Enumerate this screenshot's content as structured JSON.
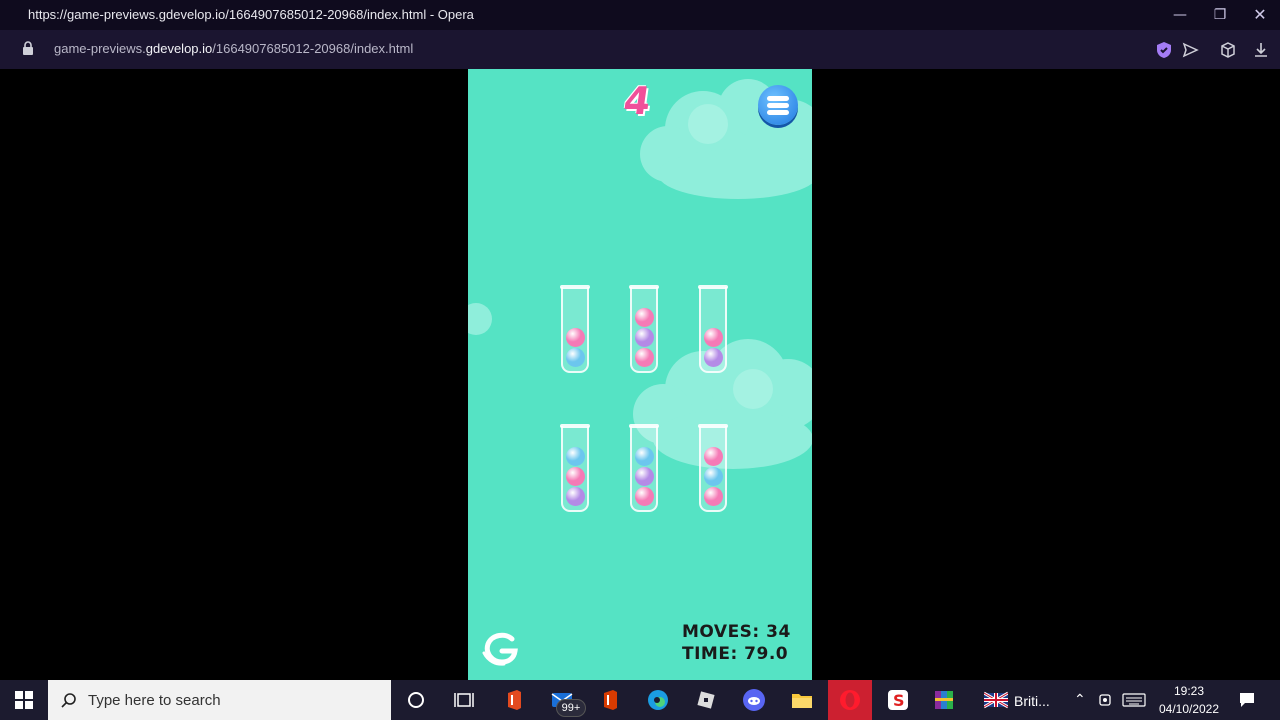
{
  "browser": {
    "window_title": "https://game-previews.gdevelop.io/1664907685012-20968/index.html - Opera",
    "url_prefix": "game-previews.",
    "url_domain": "gdevelop.io",
    "url_path": "/1664907685012-20968/index.html"
  },
  "game": {
    "level": "4",
    "moves_label": "MOVES: 34",
    "time_label": "TIME: 79.0",
    "colors": {
      "background": "#55e3c4",
      "pink": "#f57ab6",
      "purple": "#b48ae6",
      "blue": "#6cc6ee"
    },
    "tubes": [
      {
        "balls": [
          "pink",
          "blue"
        ]
      },
      {
        "balls": [
          "pink",
          "purple",
          "pink"
        ]
      },
      {
        "balls": [
          "pink",
          "purple"
        ]
      },
      {
        "balls": [
          "blue",
          "pink",
          "purple"
        ]
      },
      {
        "balls": [
          "blue",
          "purple",
          "pink"
        ]
      },
      {
        "balls": [
          "pink",
          "blue",
          "pink"
        ]
      }
    ]
  },
  "taskbar": {
    "search_placeholder": "Type here to search",
    "mail_badge": "99+",
    "language": "Briti...",
    "time": "19:23",
    "date": "04/10/2022"
  }
}
